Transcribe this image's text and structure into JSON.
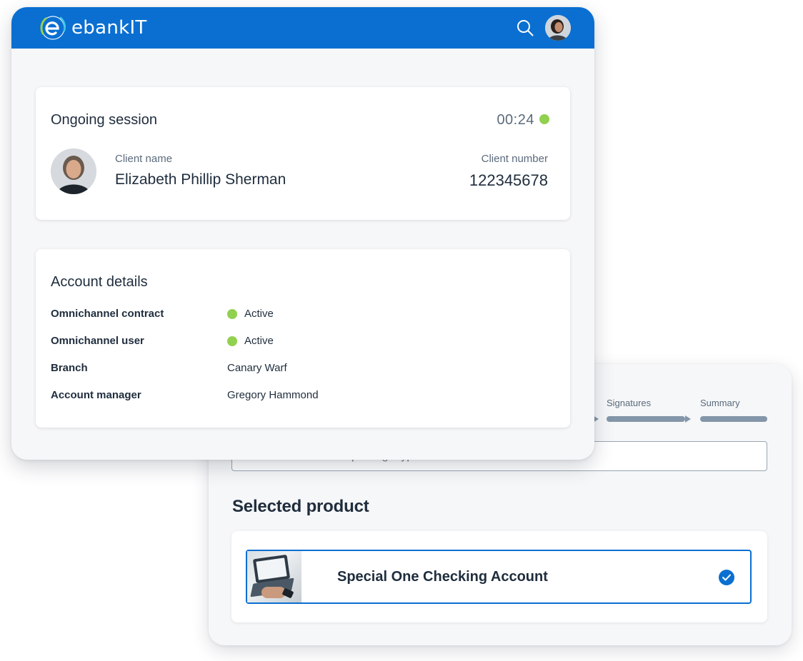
{
  "app": {
    "brand": "ebankIT",
    "colors": {
      "primary": "#0a6fd1",
      "active_status": "#92d050",
      "text": "#1f2d3d",
      "muted": "#5b6b7c"
    }
  },
  "header": {
    "logo_text": "ebankIT",
    "icons": [
      "search-icon",
      "avatar"
    ]
  },
  "session": {
    "title": "Ongoing session",
    "timer": "00:24",
    "client_name_label": "Client name",
    "client_name": "Elizabeth Phillip Sherman",
    "client_number_label": "Client number",
    "client_number": "122345678"
  },
  "account_details": {
    "title": "Account details",
    "rows": [
      {
        "label": "Omnichannel contract",
        "value": "Active",
        "status": "active"
      },
      {
        "label": "Omnichannel user",
        "value": "Active",
        "status": "active"
      },
      {
        "label": "Branch",
        "value": "Canary Warf"
      },
      {
        "label": "Account manager",
        "value": "Gregory Hammond"
      }
    ]
  },
  "wizard": {
    "steps": [
      {
        "label": "Signatures"
      },
      {
        "label": "Summary"
      }
    ],
    "search_placeholder": "Search for a contract package type",
    "selected_title": "Selected product",
    "selected_product": {
      "name": "Special One Checking Account",
      "selected": true
    }
  }
}
